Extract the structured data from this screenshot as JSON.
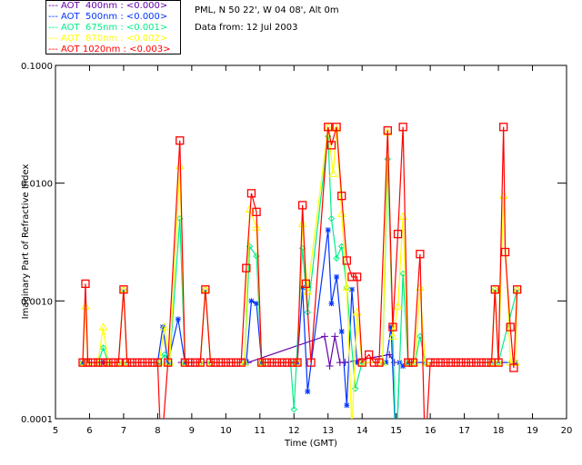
{
  "header": {
    "site": "PML, N 50 22', W 04 08', Alt 0m",
    "date": "Data from: 12 Jul 2003"
  },
  "legend": [
    {
      "label": "--- AOT  400nm : <0.000>",
      "color": "#6600aa"
    },
    {
      "label": "--- AOT  500nm : <0.000>",
      "color": "#0033ff"
    },
    {
      "label": "--- AOT  675nm : <0.001>",
      "color": "#00ee88"
    },
    {
      "label": "--- AOT  870nm : <0.002>",
      "color": "#ffff00"
    },
    {
      "label": "--- AOT 1020nm : <0.003>",
      "color": "#ff0000"
    }
  ],
  "chart_data": {
    "type": "line",
    "title": "",
    "xlabel": "Time (GMT)",
    "ylabel": "Imaginary Part of Refractive Index",
    "xlim": [
      5,
      20
    ],
    "ylim": [
      0.0001,
      0.1
    ],
    "yscale": "log",
    "xticks": [
      "5",
      "6",
      "7",
      "8",
      "9",
      "10",
      "11",
      "12",
      "13",
      "14",
      "15",
      "16",
      "17",
      "18",
      "19",
      "20"
    ],
    "yticks": [
      "0.0001",
      "0.0010",
      "0.0100",
      "0.1000"
    ],
    "grid": false,
    "legend_position": "top-left",
    "series": [
      {
        "name": "AOT 400nm",
        "color": "#6600aa",
        "marker": "plus",
        "points": [
          [
            8.7,
            0.0003
          ],
          [
            8.85,
            0.0003
          ],
          [
            9.0,
            0.0003
          ],
          [
            10.5,
            0.0003
          ],
          [
            10.65,
            0.0003
          ],
          [
            12.9,
            0.0005
          ],
          [
            13.05,
            0.00028
          ],
          [
            13.2,
            0.0005
          ],
          [
            13.35,
            0.0003
          ],
          [
            13.5,
            0.0003
          ],
          [
            14.8,
            0.00035
          ],
          [
            14.95,
            0.0003
          ]
        ]
      },
      {
        "name": "AOT 500nm",
        "color": "#0033ff",
        "marker": "star",
        "points": [
          [
            5.8,
            0.0003
          ],
          [
            6.4,
            0.0003
          ],
          [
            8.0,
            0.0003
          ],
          [
            8.15,
            0.0006
          ],
          [
            8.3,
            0.0003
          ],
          [
            8.6,
            0.0007
          ],
          [
            8.8,
            0.0003
          ],
          [
            10.6,
            0.0003
          ],
          [
            10.75,
            0.001
          ],
          [
            10.9,
            0.00095
          ],
          [
            11.05,
            0.0003
          ],
          [
            12.1,
            0.0003
          ],
          [
            12.25,
            0.0013
          ],
          [
            12.4,
            0.00017
          ],
          [
            13.0,
            0.004
          ],
          [
            13.1,
            0.00095
          ],
          [
            13.25,
            0.0016
          ],
          [
            13.4,
            0.00055
          ],
          [
            13.55,
            0.00013
          ],
          [
            13.7,
            0.00125
          ],
          [
            13.85,
            0.0003
          ],
          [
            14.7,
            0.0003
          ],
          [
            14.85,
            0.0006
          ],
          [
            15.0,
            5e-05
          ],
          [
            15.1,
            0.0003
          ],
          [
            15.2,
            0.00028
          ],
          [
            15.35,
            0.0003
          ],
          [
            18.5,
            0.0003
          ]
        ]
      },
      {
        "name": "AOT 675nm",
        "color": "#00ee88",
        "marker": "diamond",
        "points": [
          [
            5.8,
            0.0003
          ],
          [
            6.25,
            0.0003
          ],
          [
            6.4,
            0.0004
          ],
          [
            6.55,
            0.0003
          ],
          [
            6.85,
            0.0003
          ],
          [
            7.0,
            0.00125
          ],
          [
            7.1,
            0.0003
          ],
          [
            8.05,
            0.0003
          ],
          [
            8.2,
            0.00035
          ],
          [
            8.35,
            0.0003
          ],
          [
            8.65,
            0.005
          ],
          [
            8.8,
            0.0003
          ],
          [
            9.25,
            0.0003
          ],
          [
            9.4,
            0.00125
          ],
          [
            9.55,
            0.0003
          ],
          [
            10.55,
            0.0003
          ],
          [
            10.7,
            0.0029
          ],
          [
            10.9,
            0.0024
          ],
          [
            11.05,
            0.0003
          ],
          [
            11.9,
            0.0003
          ],
          [
            12.0,
            0.00012
          ],
          [
            12.25,
            0.0028
          ],
          [
            12.4,
            0.0008
          ],
          [
            13.0,
            0.025
          ],
          [
            13.1,
            0.005
          ],
          [
            13.25,
            0.0023
          ],
          [
            13.4,
            0.0029
          ],
          [
            13.55,
            0.0013
          ],
          [
            13.8,
            0.00018
          ],
          [
            14.0,
            0.0003
          ],
          [
            14.6,
            0.0003
          ],
          [
            14.75,
            0.016
          ],
          [
            15.0,
            5e-05
          ],
          [
            15.2,
            0.0017
          ],
          [
            15.35,
            0.0003
          ],
          [
            15.55,
            0.0003
          ],
          [
            15.7,
            0.0005
          ],
          [
            15.85,
            0.0003
          ],
          [
            17.8,
            0.0003
          ],
          [
            17.9,
            0.00125
          ],
          [
            18.0,
            0.0003
          ],
          [
            18.55,
            0.00125
          ]
        ]
      },
      {
        "name": "AOT 870nm",
        "color": "#ffff00",
        "marker": "triangle",
        "points": [
          [
            5.8,
            0.0003
          ],
          [
            5.88,
            0.0009
          ],
          [
            5.95,
            0.0003
          ],
          [
            6.25,
            0.0003
          ],
          [
            6.4,
            0.0006
          ],
          [
            6.55,
            0.0003
          ],
          [
            6.85,
            0.0003
          ],
          [
            7.0,
            0.00125
          ],
          [
            7.1,
            0.0003
          ],
          [
            8.05,
            0.0003
          ],
          [
            8.2,
            0.0006
          ],
          [
            8.35,
            0.0003
          ],
          [
            8.65,
            0.014
          ],
          [
            8.8,
            0.0003
          ],
          [
            9.25,
            0.0003
          ],
          [
            9.4,
            0.00125
          ],
          [
            9.55,
            0.0003
          ],
          [
            10.55,
            0.0003
          ],
          [
            10.7,
            0.006
          ],
          [
            10.9,
            0.0042
          ],
          [
            11.05,
            0.0003
          ],
          [
            12.1,
            0.0003
          ],
          [
            12.25,
            0.0045
          ],
          [
            12.4,
            0.0012
          ],
          [
            13.0,
            0.03
          ],
          [
            13.15,
            0.012
          ],
          [
            13.25,
            0.029
          ],
          [
            13.4,
            0.0055
          ],
          [
            13.55,
            0.0013
          ],
          [
            13.7,
            8e-05
          ],
          [
            13.85,
            0.0008
          ],
          [
            14.0,
            0.0003
          ],
          [
            14.6,
            0.0003
          ],
          [
            14.75,
            0.027
          ],
          [
            14.9,
            0.0005
          ],
          [
            15.05,
            0.0009
          ],
          [
            15.2,
            0.0052
          ],
          [
            15.35,
            0.0003
          ],
          [
            15.55,
            0.0003
          ],
          [
            15.7,
            0.0013
          ],
          [
            15.85,
            0.0003
          ],
          [
            17.8,
            0.0003
          ],
          [
            17.9,
            0.00125
          ],
          [
            18.0,
            0.0003
          ],
          [
            18.15,
            0.0078
          ],
          [
            18.35,
            0.0003
          ],
          [
            18.5,
            0.0003
          ],
          [
            18.55,
            0.00125
          ]
        ]
      },
      {
        "name": "AOT 1020nm",
        "color": "#ff0000",
        "marker": "square",
        "points": [
          [
            5.8,
            0.0003
          ],
          [
            5.88,
            0.0014
          ],
          [
            5.95,
            0.0003
          ],
          [
            6.1,
            0.0003
          ],
          [
            6.25,
            0.0003
          ],
          [
            6.4,
            0.0003
          ],
          [
            6.55,
            0.0003
          ],
          [
            6.7,
            0.0003
          ],
          [
            6.85,
            0.0003
          ],
          [
            7.0,
            0.00125
          ],
          [
            7.1,
            0.0003
          ],
          [
            7.25,
            0.0003
          ],
          [
            7.4,
            0.0003
          ],
          [
            7.55,
            0.0003
          ],
          [
            7.7,
            0.0003
          ],
          [
            7.85,
            0.0003
          ],
          [
            8.0,
            0.0003
          ],
          [
            8.1,
            5e-05
          ],
          [
            8.3,
            0.0003
          ],
          [
            8.65,
            0.023
          ],
          [
            8.8,
            0.0003
          ],
          [
            8.95,
            0.0003
          ],
          [
            9.1,
            0.0003
          ],
          [
            9.25,
            0.0003
          ],
          [
            9.4,
            0.00125
          ],
          [
            9.55,
            0.0003
          ],
          [
            9.7,
            0.0003
          ],
          [
            9.85,
            0.0003
          ],
          [
            10.0,
            0.0003
          ],
          [
            10.15,
            0.0003
          ],
          [
            10.3,
            0.0003
          ],
          [
            10.45,
            0.0003
          ],
          [
            10.6,
            0.0019
          ],
          [
            10.75,
            0.0082
          ],
          [
            10.9,
            0.0057
          ],
          [
            11.05,
            0.0003
          ],
          [
            11.2,
            0.0003
          ],
          [
            11.35,
            0.0003
          ],
          [
            11.5,
            0.0003
          ],
          [
            11.65,
            0.0003
          ],
          [
            11.8,
            0.0003
          ],
          [
            11.95,
            0.0003
          ],
          [
            12.1,
            0.0003
          ],
          [
            12.25,
            0.0065
          ],
          [
            12.35,
            0.0014
          ],
          [
            12.5,
            0.0003
          ],
          [
            13.0,
            0.03
          ],
          [
            13.1,
            0.021
          ],
          [
            13.25,
            0.03
          ],
          [
            13.4,
            0.0078
          ],
          [
            13.55,
            0.0022
          ],
          [
            13.7,
            0.0016
          ],
          [
            13.85,
            0.0016
          ],
          [
            14.0,
            0.0003
          ],
          [
            14.2,
            0.00035
          ],
          [
            14.35,
            0.0003
          ],
          [
            14.5,
            0.0003
          ],
          [
            14.75,
            0.028
          ],
          [
            14.9,
            0.0006
          ],
          [
            15.05,
            0.0037
          ],
          [
            15.2,
            0.03
          ],
          [
            15.35,
            0.0003
          ],
          [
            15.5,
            0.0003
          ],
          [
            15.7,
            0.0025
          ],
          [
            15.85,
            5e-05
          ],
          [
            16.0,
            0.0003
          ],
          [
            16.15,
            0.0003
          ],
          [
            16.3,
            0.0003
          ],
          [
            16.45,
            0.0003
          ],
          [
            16.6,
            0.0003
          ],
          [
            16.75,
            0.0003
          ],
          [
            16.9,
            0.0003
          ],
          [
            17.05,
            0.0003
          ],
          [
            17.2,
            0.0003
          ],
          [
            17.35,
            0.0003
          ],
          [
            17.5,
            0.0003
          ],
          [
            17.65,
            0.0003
          ],
          [
            17.8,
            0.0003
          ],
          [
            17.9,
            0.00125
          ],
          [
            18.0,
            0.0003
          ],
          [
            18.15,
            0.03
          ],
          [
            18.2,
            0.0026
          ],
          [
            18.35,
            0.0006
          ],
          [
            18.45,
            0.00027
          ],
          [
            18.55,
            0.00125
          ]
        ]
      }
    ]
  }
}
